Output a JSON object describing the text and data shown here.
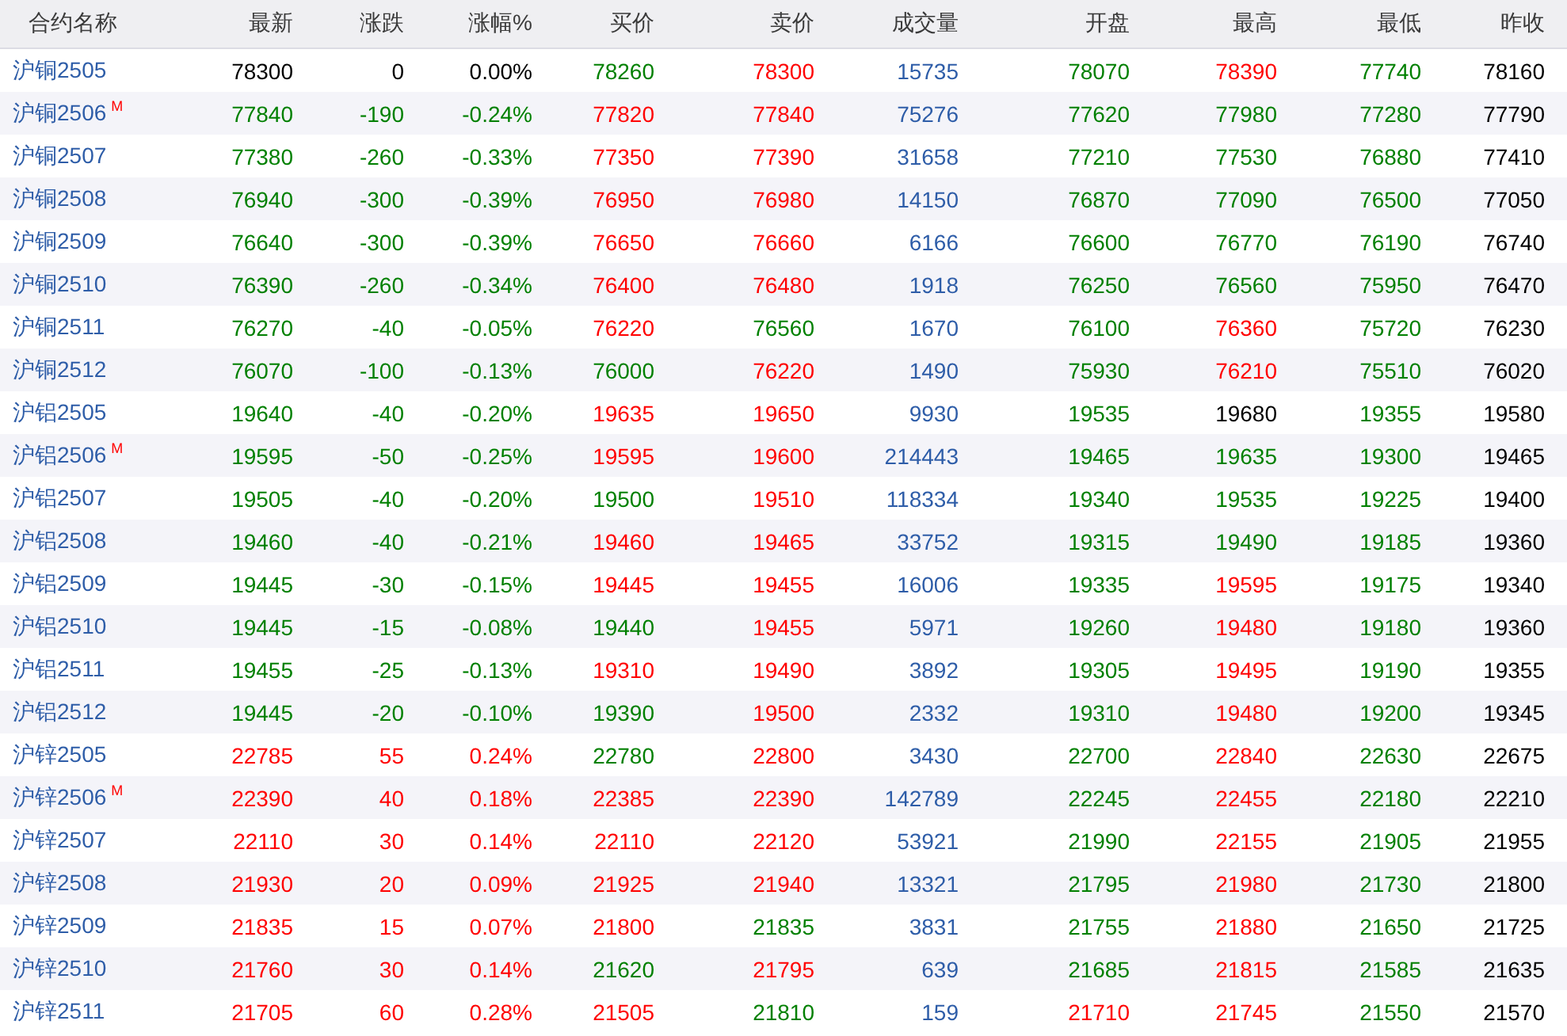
{
  "table": {
    "columns": [
      "合约名称",
      "最新",
      "涨跌",
      "涨幅%",
      "买价",
      "卖价",
      "成交量",
      "开盘",
      "最高",
      "最低",
      "昨收"
    ],
    "rows": [
      {
        "cells": [
          {
            "text": "沪铜2505",
            "color": "#2e5da8"
          },
          {
            "text": "78300",
            "color": "#000000"
          },
          {
            "text": "0",
            "color": "#000000"
          },
          {
            "text": "0.00%",
            "color": "#000000"
          },
          {
            "text": "78260",
            "color": "#008000"
          },
          {
            "text": "78300",
            "color": "#ff0000"
          },
          {
            "text": "15735",
            "color": "#2e5da8"
          },
          {
            "text": "78070",
            "color": "#008000"
          },
          {
            "text": "78390",
            "color": "#ff0000"
          },
          {
            "text": "77740",
            "color": "#008000"
          },
          {
            "text": "78160",
            "color": "#000000"
          }
        ]
      },
      {
        "cells": [
          {
            "text": "沪铜2506",
            "badge": "M",
            "color": "#2e5da8"
          },
          {
            "text": "77840",
            "color": "#008000"
          },
          {
            "text": "-190",
            "color": "#008000"
          },
          {
            "text": "-0.24%",
            "color": "#008000"
          },
          {
            "text": "77820",
            "color": "#ff0000"
          },
          {
            "text": "77840",
            "color": "#ff0000"
          },
          {
            "text": "75276",
            "color": "#2e5da8"
          },
          {
            "text": "77620",
            "color": "#008000"
          },
          {
            "text": "77980",
            "color": "#008000"
          },
          {
            "text": "77280",
            "color": "#008000"
          },
          {
            "text": "77790",
            "color": "#000000"
          }
        ]
      },
      {
        "cells": [
          {
            "text": "沪铜2507",
            "color": "#2e5da8"
          },
          {
            "text": "77380",
            "color": "#008000"
          },
          {
            "text": "-260",
            "color": "#008000"
          },
          {
            "text": "-0.33%",
            "color": "#008000"
          },
          {
            "text": "77350",
            "color": "#ff0000"
          },
          {
            "text": "77390",
            "color": "#ff0000"
          },
          {
            "text": "31658",
            "color": "#2e5da8"
          },
          {
            "text": "77210",
            "color": "#008000"
          },
          {
            "text": "77530",
            "color": "#008000"
          },
          {
            "text": "76880",
            "color": "#008000"
          },
          {
            "text": "77410",
            "color": "#000000"
          }
        ]
      },
      {
        "cells": [
          {
            "text": "沪铜2508",
            "color": "#2e5da8"
          },
          {
            "text": "76940",
            "color": "#008000"
          },
          {
            "text": "-300",
            "color": "#008000"
          },
          {
            "text": "-0.39%",
            "color": "#008000"
          },
          {
            "text": "76950",
            "color": "#ff0000"
          },
          {
            "text": "76980",
            "color": "#ff0000"
          },
          {
            "text": "14150",
            "color": "#2e5da8"
          },
          {
            "text": "76870",
            "color": "#008000"
          },
          {
            "text": "77090",
            "color": "#008000"
          },
          {
            "text": "76500",
            "color": "#008000"
          },
          {
            "text": "77050",
            "color": "#000000"
          }
        ]
      },
      {
        "cells": [
          {
            "text": "沪铜2509",
            "color": "#2e5da8"
          },
          {
            "text": "76640",
            "color": "#008000"
          },
          {
            "text": "-300",
            "color": "#008000"
          },
          {
            "text": "-0.39%",
            "color": "#008000"
          },
          {
            "text": "76650",
            "color": "#ff0000"
          },
          {
            "text": "76660",
            "color": "#ff0000"
          },
          {
            "text": "6166",
            "color": "#2e5da8"
          },
          {
            "text": "76600",
            "color": "#008000"
          },
          {
            "text": "76770",
            "color": "#008000"
          },
          {
            "text": "76190",
            "color": "#008000"
          },
          {
            "text": "76740",
            "color": "#000000"
          }
        ]
      },
      {
        "cells": [
          {
            "text": "沪铜2510",
            "color": "#2e5da8"
          },
          {
            "text": "76390",
            "color": "#008000"
          },
          {
            "text": "-260",
            "color": "#008000"
          },
          {
            "text": "-0.34%",
            "color": "#008000"
          },
          {
            "text": "76400",
            "color": "#ff0000"
          },
          {
            "text": "76480",
            "color": "#ff0000"
          },
          {
            "text": "1918",
            "color": "#2e5da8"
          },
          {
            "text": "76250",
            "color": "#008000"
          },
          {
            "text": "76560",
            "color": "#008000"
          },
          {
            "text": "75950",
            "color": "#008000"
          },
          {
            "text": "76470",
            "color": "#000000"
          }
        ]
      },
      {
        "cells": [
          {
            "text": "沪铜2511",
            "color": "#2e5da8"
          },
          {
            "text": "76270",
            "color": "#008000"
          },
          {
            "text": "-40",
            "color": "#008000"
          },
          {
            "text": "-0.05%",
            "color": "#008000"
          },
          {
            "text": "76220",
            "color": "#ff0000"
          },
          {
            "text": "76560",
            "color": "#008000"
          },
          {
            "text": "1670",
            "color": "#2e5da8"
          },
          {
            "text": "76100",
            "color": "#008000"
          },
          {
            "text": "76360",
            "color": "#ff0000"
          },
          {
            "text": "75720",
            "color": "#008000"
          },
          {
            "text": "76230",
            "color": "#000000"
          }
        ]
      },
      {
        "cells": [
          {
            "text": "沪铜2512",
            "color": "#2e5da8"
          },
          {
            "text": "76070",
            "color": "#008000"
          },
          {
            "text": "-100",
            "color": "#008000"
          },
          {
            "text": "-0.13%",
            "color": "#008000"
          },
          {
            "text": "76000",
            "color": "#008000"
          },
          {
            "text": "76220",
            "color": "#ff0000"
          },
          {
            "text": "1490",
            "color": "#2e5da8"
          },
          {
            "text": "75930",
            "color": "#008000"
          },
          {
            "text": "76210",
            "color": "#ff0000"
          },
          {
            "text": "75510",
            "color": "#008000"
          },
          {
            "text": "76020",
            "color": "#000000"
          }
        ]
      },
      {
        "cells": [
          {
            "text": "沪铝2505",
            "color": "#2e5da8"
          },
          {
            "text": "19640",
            "color": "#008000"
          },
          {
            "text": "-40",
            "color": "#008000"
          },
          {
            "text": "-0.20%",
            "color": "#008000"
          },
          {
            "text": "19635",
            "color": "#ff0000"
          },
          {
            "text": "19650",
            "color": "#ff0000"
          },
          {
            "text": "9930",
            "color": "#2e5da8"
          },
          {
            "text": "19535",
            "color": "#008000"
          },
          {
            "text": "19680",
            "color": "#000000"
          },
          {
            "text": "19355",
            "color": "#008000"
          },
          {
            "text": "19580",
            "color": "#000000"
          }
        ]
      },
      {
        "cells": [
          {
            "text": "沪铝2506",
            "badge": "M",
            "color": "#2e5da8"
          },
          {
            "text": "19595",
            "color": "#008000"
          },
          {
            "text": "-50",
            "color": "#008000"
          },
          {
            "text": "-0.25%",
            "color": "#008000"
          },
          {
            "text": "19595",
            "color": "#ff0000"
          },
          {
            "text": "19600",
            "color": "#ff0000"
          },
          {
            "text": "214443",
            "color": "#2e5da8"
          },
          {
            "text": "19465",
            "color": "#008000"
          },
          {
            "text": "19635",
            "color": "#008000"
          },
          {
            "text": "19300",
            "color": "#008000"
          },
          {
            "text": "19465",
            "color": "#000000"
          }
        ]
      },
      {
        "cells": [
          {
            "text": "沪铝2507",
            "color": "#2e5da8"
          },
          {
            "text": "19505",
            "color": "#008000"
          },
          {
            "text": "-40",
            "color": "#008000"
          },
          {
            "text": "-0.20%",
            "color": "#008000"
          },
          {
            "text": "19500",
            "color": "#008000"
          },
          {
            "text": "19510",
            "color": "#ff0000"
          },
          {
            "text": "118334",
            "color": "#2e5da8"
          },
          {
            "text": "19340",
            "color": "#008000"
          },
          {
            "text": "19535",
            "color": "#008000"
          },
          {
            "text": "19225",
            "color": "#008000"
          },
          {
            "text": "19400",
            "color": "#000000"
          }
        ]
      },
      {
        "cells": [
          {
            "text": "沪铝2508",
            "color": "#2e5da8"
          },
          {
            "text": "19460",
            "color": "#008000"
          },
          {
            "text": "-40",
            "color": "#008000"
          },
          {
            "text": "-0.21%",
            "color": "#008000"
          },
          {
            "text": "19460",
            "color": "#ff0000"
          },
          {
            "text": "19465",
            "color": "#ff0000"
          },
          {
            "text": "33752",
            "color": "#2e5da8"
          },
          {
            "text": "19315",
            "color": "#008000"
          },
          {
            "text": "19490",
            "color": "#008000"
          },
          {
            "text": "19185",
            "color": "#008000"
          },
          {
            "text": "19360",
            "color": "#000000"
          }
        ]
      },
      {
        "cells": [
          {
            "text": "沪铝2509",
            "color": "#2e5da8"
          },
          {
            "text": "19445",
            "color": "#008000"
          },
          {
            "text": "-30",
            "color": "#008000"
          },
          {
            "text": "-0.15%",
            "color": "#008000"
          },
          {
            "text": "19445",
            "color": "#ff0000"
          },
          {
            "text": "19455",
            "color": "#ff0000"
          },
          {
            "text": "16006",
            "color": "#2e5da8"
          },
          {
            "text": "19335",
            "color": "#008000"
          },
          {
            "text": "19595",
            "color": "#ff0000"
          },
          {
            "text": "19175",
            "color": "#008000"
          },
          {
            "text": "19340",
            "color": "#000000"
          }
        ]
      },
      {
        "cells": [
          {
            "text": "沪铝2510",
            "color": "#2e5da8"
          },
          {
            "text": "19445",
            "color": "#008000"
          },
          {
            "text": "-15",
            "color": "#008000"
          },
          {
            "text": "-0.08%",
            "color": "#008000"
          },
          {
            "text": "19440",
            "color": "#008000"
          },
          {
            "text": "19455",
            "color": "#ff0000"
          },
          {
            "text": "5971",
            "color": "#2e5da8"
          },
          {
            "text": "19260",
            "color": "#008000"
          },
          {
            "text": "19480",
            "color": "#ff0000"
          },
          {
            "text": "19180",
            "color": "#008000"
          },
          {
            "text": "19360",
            "color": "#000000"
          }
        ]
      },
      {
        "cells": [
          {
            "text": "沪铝2511",
            "color": "#2e5da8"
          },
          {
            "text": "19455",
            "color": "#008000"
          },
          {
            "text": "-25",
            "color": "#008000"
          },
          {
            "text": "-0.13%",
            "color": "#008000"
          },
          {
            "text": "19310",
            "color": "#ff0000"
          },
          {
            "text": "19490",
            "color": "#ff0000"
          },
          {
            "text": "3892",
            "color": "#2e5da8"
          },
          {
            "text": "19305",
            "color": "#008000"
          },
          {
            "text": "19495",
            "color": "#ff0000"
          },
          {
            "text": "19190",
            "color": "#008000"
          },
          {
            "text": "19355",
            "color": "#000000"
          }
        ]
      },
      {
        "cells": [
          {
            "text": "沪铝2512",
            "color": "#2e5da8"
          },
          {
            "text": "19445",
            "color": "#008000"
          },
          {
            "text": "-20",
            "color": "#008000"
          },
          {
            "text": "-0.10%",
            "color": "#008000"
          },
          {
            "text": "19390",
            "color": "#008000"
          },
          {
            "text": "19500",
            "color": "#ff0000"
          },
          {
            "text": "2332",
            "color": "#2e5da8"
          },
          {
            "text": "19310",
            "color": "#008000"
          },
          {
            "text": "19480",
            "color": "#ff0000"
          },
          {
            "text": "19200",
            "color": "#008000"
          },
          {
            "text": "19345",
            "color": "#000000"
          }
        ]
      },
      {
        "cells": [
          {
            "text": "沪锌2505",
            "color": "#2e5da8"
          },
          {
            "text": "22785",
            "color": "#ff0000"
          },
          {
            "text": "55",
            "color": "#ff0000"
          },
          {
            "text": "0.24%",
            "color": "#ff0000"
          },
          {
            "text": "22780",
            "color": "#008000"
          },
          {
            "text": "22800",
            "color": "#ff0000"
          },
          {
            "text": "3430",
            "color": "#2e5da8"
          },
          {
            "text": "22700",
            "color": "#008000"
          },
          {
            "text": "22840",
            "color": "#ff0000"
          },
          {
            "text": "22630",
            "color": "#008000"
          },
          {
            "text": "22675",
            "color": "#000000"
          }
        ]
      },
      {
        "cells": [
          {
            "text": "沪锌2506",
            "badge": "M",
            "color": "#2e5da8"
          },
          {
            "text": "22390",
            "color": "#ff0000"
          },
          {
            "text": "40",
            "color": "#ff0000"
          },
          {
            "text": "0.18%",
            "color": "#ff0000"
          },
          {
            "text": "22385",
            "color": "#ff0000"
          },
          {
            "text": "22390",
            "color": "#ff0000"
          },
          {
            "text": "142789",
            "color": "#2e5da8"
          },
          {
            "text": "22245",
            "color": "#008000"
          },
          {
            "text": "22455",
            "color": "#ff0000"
          },
          {
            "text": "22180",
            "color": "#008000"
          },
          {
            "text": "22210",
            "color": "#000000"
          }
        ]
      },
      {
        "cells": [
          {
            "text": "沪锌2507",
            "color": "#2e5da8"
          },
          {
            "text": "22110",
            "color": "#ff0000"
          },
          {
            "text": "30",
            "color": "#ff0000"
          },
          {
            "text": "0.14%",
            "color": "#ff0000"
          },
          {
            "text": "22110",
            "color": "#ff0000"
          },
          {
            "text": "22120",
            "color": "#ff0000"
          },
          {
            "text": "53921",
            "color": "#2e5da8"
          },
          {
            "text": "21990",
            "color": "#008000"
          },
          {
            "text": "22155",
            "color": "#ff0000"
          },
          {
            "text": "21905",
            "color": "#008000"
          },
          {
            "text": "21955",
            "color": "#000000"
          }
        ]
      },
      {
        "cells": [
          {
            "text": "沪锌2508",
            "color": "#2e5da8"
          },
          {
            "text": "21930",
            "color": "#ff0000"
          },
          {
            "text": "20",
            "color": "#ff0000"
          },
          {
            "text": "0.09%",
            "color": "#ff0000"
          },
          {
            "text": "21925",
            "color": "#ff0000"
          },
          {
            "text": "21940",
            "color": "#ff0000"
          },
          {
            "text": "13321",
            "color": "#2e5da8"
          },
          {
            "text": "21795",
            "color": "#008000"
          },
          {
            "text": "21980",
            "color": "#ff0000"
          },
          {
            "text": "21730",
            "color": "#008000"
          },
          {
            "text": "21800",
            "color": "#000000"
          }
        ]
      },
      {
        "cells": [
          {
            "text": "沪锌2509",
            "color": "#2e5da8"
          },
          {
            "text": "21835",
            "color": "#ff0000"
          },
          {
            "text": "15",
            "color": "#ff0000"
          },
          {
            "text": "0.07%",
            "color": "#ff0000"
          },
          {
            "text": "21800",
            "color": "#ff0000"
          },
          {
            "text": "21835",
            "color": "#008000"
          },
          {
            "text": "3831",
            "color": "#2e5da8"
          },
          {
            "text": "21755",
            "color": "#008000"
          },
          {
            "text": "21880",
            "color": "#ff0000"
          },
          {
            "text": "21650",
            "color": "#008000"
          },
          {
            "text": "21725",
            "color": "#000000"
          }
        ]
      },
      {
        "cells": [
          {
            "text": "沪锌2510",
            "color": "#2e5da8"
          },
          {
            "text": "21760",
            "color": "#ff0000"
          },
          {
            "text": "30",
            "color": "#ff0000"
          },
          {
            "text": "0.14%",
            "color": "#ff0000"
          },
          {
            "text": "21620",
            "color": "#008000"
          },
          {
            "text": "21795",
            "color": "#ff0000"
          },
          {
            "text": "639",
            "color": "#2e5da8"
          },
          {
            "text": "21685",
            "color": "#008000"
          },
          {
            "text": "21815",
            "color": "#ff0000"
          },
          {
            "text": "21585",
            "color": "#008000"
          },
          {
            "text": "21635",
            "color": "#000000"
          }
        ]
      },
      {
        "cells": [
          {
            "text": "沪锌2511",
            "color": "#2e5da8"
          },
          {
            "text": "21705",
            "color": "#ff0000"
          },
          {
            "text": "60",
            "color": "#ff0000"
          },
          {
            "text": "0.28%",
            "color": "#ff0000"
          },
          {
            "text": "21505",
            "color": "#ff0000"
          },
          {
            "text": "21810",
            "color": "#008000"
          },
          {
            "text": "159",
            "color": "#2e5da8"
          },
          {
            "text": "21710",
            "color": "#ff0000"
          },
          {
            "text": "21745",
            "color": "#ff0000"
          },
          {
            "text": "21550",
            "color": "#008000"
          },
          {
            "text": "21570",
            "color": "#000000"
          }
        ]
      }
    ]
  }
}
